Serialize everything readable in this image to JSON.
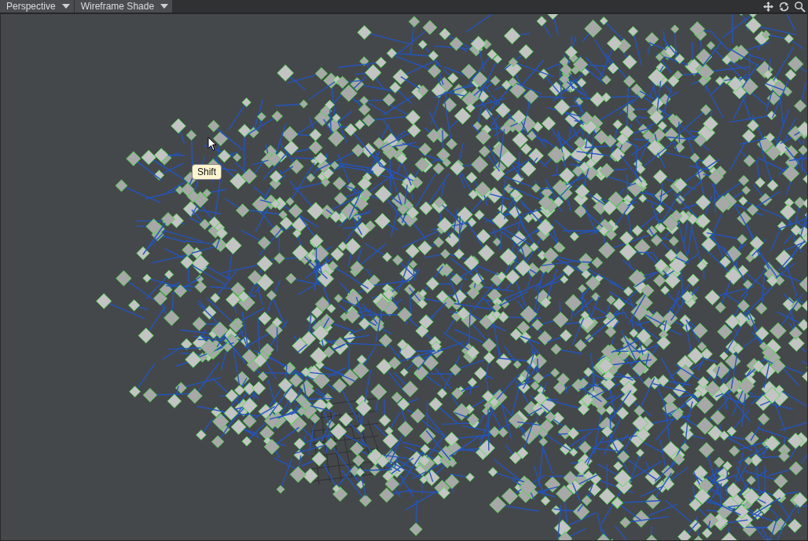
{
  "toolbar": {
    "dropdowns": [
      {
        "label": "Perspective"
      },
      {
        "label": "Wireframe Shade"
      }
    ]
  },
  "viewport": {
    "tooltip": "Shift"
  }
}
